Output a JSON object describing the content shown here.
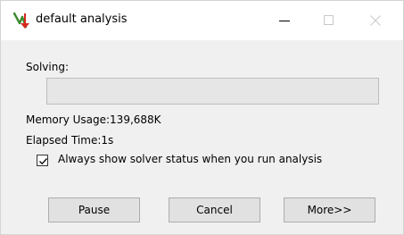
{
  "window": {
    "title": "default analysis",
    "controls": [
      "minimize",
      "maximize",
      "close"
    ]
  },
  "status": {
    "solving_label": "Solving:",
    "progress_fraction": 0,
    "memory_usage": "Memory Usage:139,688K",
    "elapsed_time": "Elapsed Time:1s"
  },
  "options": {
    "always_show_checked": true,
    "always_show_label": "Always show solver status when you run analysis"
  },
  "buttons": {
    "pause": "Pause",
    "cancel": "Cancel",
    "more": "More>>"
  },
  "icons": {
    "app": "solver-app-icon",
    "minimize": "minimize-icon",
    "maximize": "maximize-icon",
    "close": "close-icon",
    "check": "check-icon"
  },
  "colors": {
    "app_icon_green": "#3a8a2e",
    "app_icon_red": "#d6281f",
    "progress_fill": "#06b025"
  }
}
